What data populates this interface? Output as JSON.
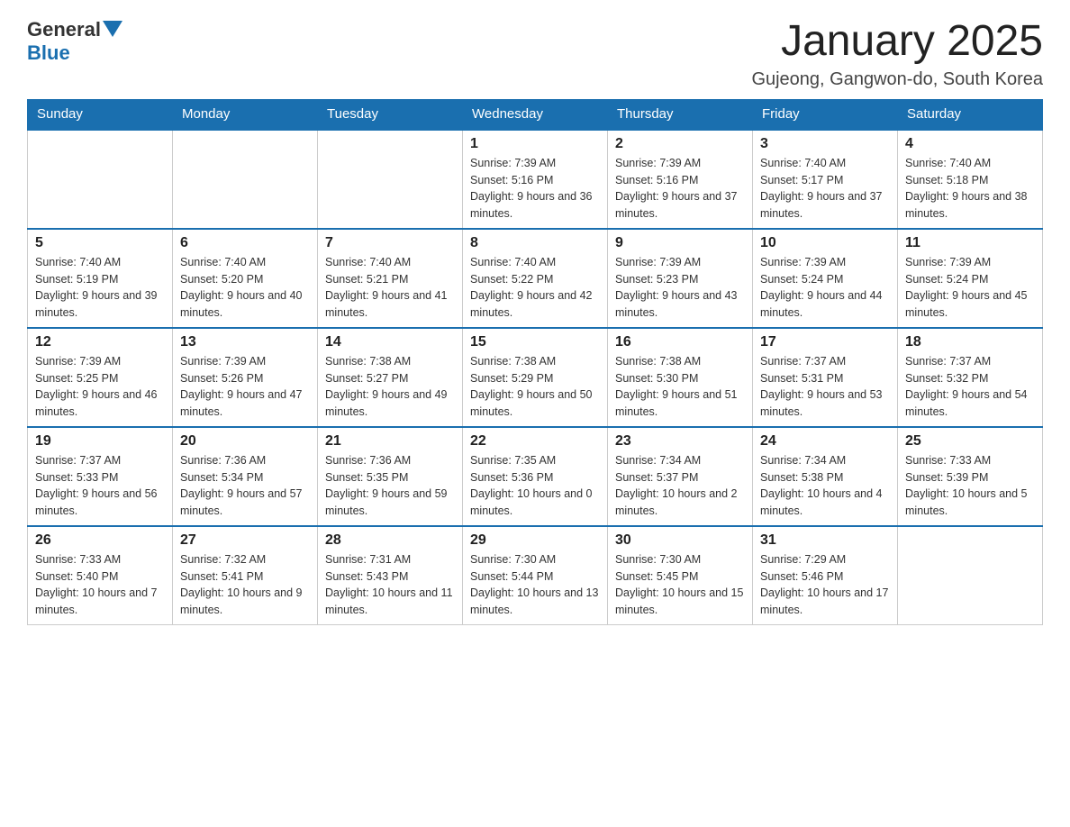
{
  "logo": {
    "general": "General",
    "blue": "Blue"
  },
  "title": "January 2025",
  "subtitle": "Gujeong, Gangwon-do, South Korea",
  "days_of_week": [
    "Sunday",
    "Monday",
    "Tuesday",
    "Wednesday",
    "Thursday",
    "Friday",
    "Saturday"
  ],
  "weeks": [
    [
      {
        "day": "",
        "info": ""
      },
      {
        "day": "",
        "info": ""
      },
      {
        "day": "",
        "info": ""
      },
      {
        "day": "1",
        "info": "Sunrise: 7:39 AM\nSunset: 5:16 PM\nDaylight: 9 hours and 36 minutes."
      },
      {
        "day": "2",
        "info": "Sunrise: 7:39 AM\nSunset: 5:16 PM\nDaylight: 9 hours and 37 minutes."
      },
      {
        "day": "3",
        "info": "Sunrise: 7:40 AM\nSunset: 5:17 PM\nDaylight: 9 hours and 37 minutes."
      },
      {
        "day": "4",
        "info": "Sunrise: 7:40 AM\nSunset: 5:18 PM\nDaylight: 9 hours and 38 minutes."
      }
    ],
    [
      {
        "day": "5",
        "info": "Sunrise: 7:40 AM\nSunset: 5:19 PM\nDaylight: 9 hours and 39 minutes."
      },
      {
        "day": "6",
        "info": "Sunrise: 7:40 AM\nSunset: 5:20 PM\nDaylight: 9 hours and 40 minutes."
      },
      {
        "day": "7",
        "info": "Sunrise: 7:40 AM\nSunset: 5:21 PM\nDaylight: 9 hours and 41 minutes."
      },
      {
        "day": "8",
        "info": "Sunrise: 7:40 AM\nSunset: 5:22 PM\nDaylight: 9 hours and 42 minutes."
      },
      {
        "day": "9",
        "info": "Sunrise: 7:39 AM\nSunset: 5:23 PM\nDaylight: 9 hours and 43 minutes."
      },
      {
        "day": "10",
        "info": "Sunrise: 7:39 AM\nSunset: 5:24 PM\nDaylight: 9 hours and 44 minutes."
      },
      {
        "day": "11",
        "info": "Sunrise: 7:39 AM\nSunset: 5:24 PM\nDaylight: 9 hours and 45 minutes."
      }
    ],
    [
      {
        "day": "12",
        "info": "Sunrise: 7:39 AM\nSunset: 5:25 PM\nDaylight: 9 hours and 46 minutes."
      },
      {
        "day": "13",
        "info": "Sunrise: 7:39 AM\nSunset: 5:26 PM\nDaylight: 9 hours and 47 minutes."
      },
      {
        "day": "14",
        "info": "Sunrise: 7:38 AM\nSunset: 5:27 PM\nDaylight: 9 hours and 49 minutes."
      },
      {
        "day": "15",
        "info": "Sunrise: 7:38 AM\nSunset: 5:29 PM\nDaylight: 9 hours and 50 minutes."
      },
      {
        "day": "16",
        "info": "Sunrise: 7:38 AM\nSunset: 5:30 PM\nDaylight: 9 hours and 51 minutes."
      },
      {
        "day": "17",
        "info": "Sunrise: 7:37 AM\nSunset: 5:31 PM\nDaylight: 9 hours and 53 minutes."
      },
      {
        "day": "18",
        "info": "Sunrise: 7:37 AM\nSunset: 5:32 PM\nDaylight: 9 hours and 54 minutes."
      }
    ],
    [
      {
        "day": "19",
        "info": "Sunrise: 7:37 AM\nSunset: 5:33 PM\nDaylight: 9 hours and 56 minutes."
      },
      {
        "day": "20",
        "info": "Sunrise: 7:36 AM\nSunset: 5:34 PM\nDaylight: 9 hours and 57 minutes."
      },
      {
        "day": "21",
        "info": "Sunrise: 7:36 AM\nSunset: 5:35 PM\nDaylight: 9 hours and 59 minutes."
      },
      {
        "day": "22",
        "info": "Sunrise: 7:35 AM\nSunset: 5:36 PM\nDaylight: 10 hours and 0 minutes."
      },
      {
        "day": "23",
        "info": "Sunrise: 7:34 AM\nSunset: 5:37 PM\nDaylight: 10 hours and 2 minutes."
      },
      {
        "day": "24",
        "info": "Sunrise: 7:34 AM\nSunset: 5:38 PM\nDaylight: 10 hours and 4 minutes."
      },
      {
        "day": "25",
        "info": "Sunrise: 7:33 AM\nSunset: 5:39 PM\nDaylight: 10 hours and 5 minutes."
      }
    ],
    [
      {
        "day": "26",
        "info": "Sunrise: 7:33 AM\nSunset: 5:40 PM\nDaylight: 10 hours and 7 minutes."
      },
      {
        "day": "27",
        "info": "Sunrise: 7:32 AM\nSunset: 5:41 PM\nDaylight: 10 hours and 9 minutes."
      },
      {
        "day": "28",
        "info": "Sunrise: 7:31 AM\nSunset: 5:43 PM\nDaylight: 10 hours and 11 minutes."
      },
      {
        "day": "29",
        "info": "Sunrise: 7:30 AM\nSunset: 5:44 PM\nDaylight: 10 hours and 13 minutes."
      },
      {
        "day": "30",
        "info": "Sunrise: 7:30 AM\nSunset: 5:45 PM\nDaylight: 10 hours and 15 minutes."
      },
      {
        "day": "31",
        "info": "Sunrise: 7:29 AM\nSunset: 5:46 PM\nDaylight: 10 hours and 17 minutes."
      },
      {
        "day": "",
        "info": ""
      }
    ]
  ]
}
